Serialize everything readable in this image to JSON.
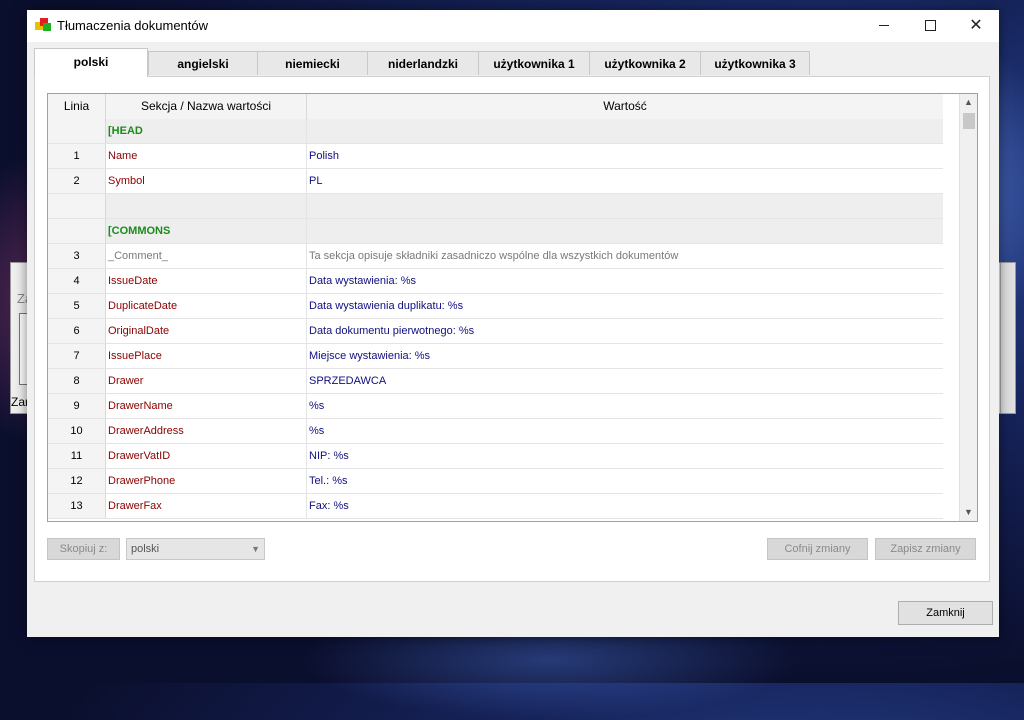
{
  "window": {
    "title": "Tłumaczenia dokumentów"
  },
  "background_window": {
    "text_top": "Za",
    "text_bottom": "Zar"
  },
  "tabs": [
    {
      "label": "polski",
      "active": true
    },
    {
      "label": "angielski"
    },
    {
      "label": "niemiecki"
    },
    {
      "label": "niderlandzki"
    },
    {
      "label": "użytkownika 1"
    },
    {
      "label": "użytkownika 2"
    },
    {
      "label": "użytkownika 3"
    }
  ],
  "grid": {
    "columns": {
      "line": "Linia",
      "section": "Sekcja / Nazwa wartości",
      "value": "Wartość"
    },
    "rows": [
      {
        "type": "section",
        "line": "",
        "name": "[HEAD",
        "value": ""
      },
      {
        "type": "key",
        "line": "1",
        "name": "Name",
        "value": "Polish"
      },
      {
        "type": "key",
        "line": "2",
        "name": "Symbol",
        "value": "PL"
      },
      {
        "type": "blank",
        "line": "",
        "name": "",
        "value": ""
      },
      {
        "type": "section",
        "line": "",
        "name": "[COMMONS",
        "value": ""
      },
      {
        "type": "comment",
        "line": "3",
        "name": "_Comment_",
        "value": "Ta sekcja opisuje składniki zasadniczo wspólne dla wszystkich dokumentów"
      },
      {
        "type": "key",
        "line": "4",
        "name": "IssueDate",
        "value": "Data wystawienia: %s"
      },
      {
        "type": "key",
        "line": "5",
        "name": "DuplicateDate",
        "value": "Data wystawienia duplikatu: %s"
      },
      {
        "type": "key",
        "line": "6",
        "name": "OriginalDate",
        "value": "Data dokumentu pierwotnego: %s"
      },
      {
        "type": "key",
        "line": "7",
        "name": "IssuePlace",
        "value": "Miejsce wystawienia: %s"
      },
      {
        "type": "key",
        "line": "8",
        "name": "Drawer",
        "value": "SPRZEDAWCA"
      },
      {
        "type": "key",
        "line": "9",
        "name": "DrawerName",
        "value": "%s"
      },
      {
        "type": "key",
        "line": "10",
        "name": "DrawerAddress",
        "value": "%s"
      },
      {
        "type": "key",
        "line": "11",
        "name": "DrawerVatID",
        "value": "NIP: %s"
      },
      {
        "type": "key",
        "line": "12",
        "name": "DrawerPhone",
        "value": "Tel.: %s"
      },
      {
        "type": "key",
        "line": "13",
        "name": "DrawerFax",
        "value": "Fax: %s"
      }
    ]
  },
  "controls": {
    "copy_label": "Skopiuj z:",
    "copy_source": "polski",
    "undo_label": "Cofnij zmiany",
    "save_label": "Zapisz zmiany",
    "close_label": "Zamknij"
  }
}
